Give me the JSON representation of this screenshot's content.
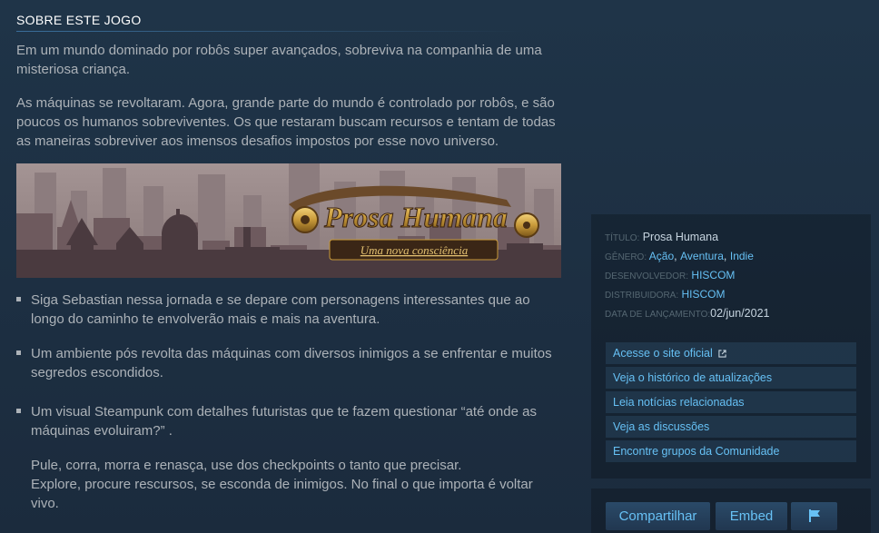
{
  "about": {
    "title": "SOBRE ESTE JOGO",
    "para1": "Em um mundo dominado por robôs super avançados, sobreviva na companhia de uma misteriosa criança.",
    "para2": "As máquinas se revoltaram. Agora, grande parte do mundo é controlado por robôs, e são poucos os humanos sobreviventes. Os que restaram buscam recursos e tentam de todas as maneiras sobreviver aos imensos desafios impostos por esse novo universo.",
    "banner": {
      "title": "Prosa Humana",
      "subtitle": "Uma nova consciência"
    },
    "bullets": [
      "Siga Sebastian nessa jornada e se depare com personagens interessantes que ao longo do caminho te envolverão mais e mais na aventura.",
      "Um ambiente pós revolta das máquinas com diversos inimigos a se enfrentar e muitos segredos escondidos.",
      "Um visual Steampunk com detalhes futuristas que te fazem questionar “até onde as máquinas evoluiram?” ."
    ],
    "para3_line1": "Pule, corra, morra e renasça, use dos checkpoints o tanto que precisar.",
    "para3_line2": "Explore, procure rescursos, se esconda de inimigos. No final o que importa é voltar vivo."
  },
  "details": {
    "title_label": "TÍTULO:",
    "title_value": "Prosa Humana",
    "genre_label": "GÊNERO:",
    "genres": [
      "Ação",
      "Aventura",
      "Indie"
    ],
    "developer_label": "DESENVOLVEDOR:",
    "developer": "HISCOM",
    "publisher_label": "DISTRIBUIDORA:",
    "publisher": "HISCOM",
    "release_label": "DATA DE LANÇAMENTO:",
    "release_date": "02/jun/2021"
  },
  "links": [
    "Acesse o site oficial",
    "Veja o histórico de atualizações",
    "Leia notícias relacionadas",
    "Veja as discussões",
    "Encontre grupos da Comunidade"
  ],
  "share": {
    "share_label": "Compartilhar",
    "embed_label": "Embed",
    "flag_icon": "flag-icon"
  },
  "colors": {
    "link": "#66c0f4",
    "text": "#acb2b8",
    "background": "#1b2838"
  }
}
